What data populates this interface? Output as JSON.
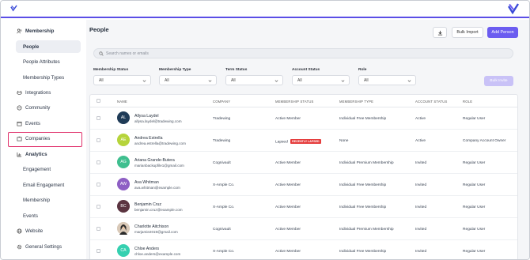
{
  "app": {
    "logo_icon": "tradewing-logo-icon",
    "accent_color": "#5b4ee6"
  },
  "sidebar": {
    "items": [
      {
        "label": "Membership",
        "icon": "people-icon",
        "level": "parent"
      },
      {
        "label": "People",
        "level": "sub",
        "active": true
      },
      {
        "label": "People Attributes",
        "level": "sub"
      },
      {
        "label": "Membership Types",
        "level": "sub"
      },
      {
        "label": "Integrations",
        "icon": "plug-icon",
        "level": "parent"
      },
      {
        "label": "Community",
        "icon": "chat-icon",
        "level": "parent"
      },
      {
        "label": "Events",
        "icon": "calendar-icon",
        "level": "parent"
      },
      {
        "label": "Companies",
        "icon": "building-icon",
        "level": "parent",
        "highlighted": true
      },
      {
        "label": "Analytics",
        "icon": "chart-icon",
        "level": "parent",
        "bold": true
      },
      {
        "label": "Engagement",
        "level": "sub"
      },
      {
        "label": "Email Engagement",
        "level": "sub"
      },
      {
        "label": "Membership",
        "level": "sub"
      },
      {
        "label": "Events",
        "level": "sub"
      },
      {
        "label": "Website",
        "icon": "globe-icon",
        "level": "parent"
      },
      {
        "label": "General Settings",
        "icon": "gear-icon",
        "level": "parent"
      }
    ]
  },
  "header": {
    "title": "People",
    "download_icon": "download-icon",
    "bulk_import_label": "Bulk Import",
    "add_person_label": "Add Person"
  },
  "search": {
    "placeholder": "Search names or emails",
    "icon": "search-icon"
  },
  "filters": [
    {
      "label": "Membership Status",
      "value": "All"
    },
    {
      "label": "Membership Type",
      "value": "All"
    },
    {
      "label": "Term Status",
      "value": "All"
    },
    {
      "label": "Account Status",
      "value": "All"
    },
    {
      "label": "Role",
      "value": "All"
    }
  ],
  "bulk_invite_label": "Bulk Invite",
  "table": {
    "columns": [
      "NAME",
      "COMPANY",
      "MEMBERSHIP STATUS",
      "MEMBERSHIP TYPE",
      "ACCOUNT STATUS",
      "ROLE"
    ],
    "rows": [
      {
        "initials": "AL",
        "avatar_color": "#1f3b57",
        "name": "Allysa Laydel",
        "email": "allysa.laydel@tradewing.com",
        "company": "Tradewing",
        "membership_status": "Active Member",
        "badge": "",
        "membership_type": "Individual Free Membership",
        "account_status": "Active",
        "role": "Regular User"
      },
      {
        "initials": "AE",
        "avatar_color": "#b6d43b",
        "name": "Andrea Estrella",
        "email": "andrea.estrella@tradewing.com",
        "company": "Tradewing",
        "membership_status": "Lapsed",
        "badge": "RECENTLY LAPSED",
        "membership_type": "None",
        "account_status": "Active",
        "role": "Company Account Owner"
      },
      {
        "initials": "AG",
        "avatar_color": "#3fbf8f",
        "name": "Ariana Grande-Butera",
        "email": "marianbackupfile1@gmail.com",
        "company": "Cognivault",
        "membership_status": "Active Member",
        "badge": "",
        "membership_type": "Individual Premium Membership",
        "account_status": "Invited",
        "role": "Regular User"
      },
      {
        "initials": "AW",
        "avatar_color": "#8e5fc4",
        "name": "Ava Whitman",
        "email": "ava.whitman@example.com",
        "company": "X-Ample Co.",
        "membership_status": "Active Member",
        "badge": "",
        "membership_type": "Individual Free Membership",
        "account_status": "Invited",
        "role": "Regular User"
      },
      {
        "initials": "BC",
        "avatar_color": "#5b3440",
        "name": "Benjamin Cruz",
        "email": "benjamin.cruz@example.com",
        "company": "X-Ample Co.",
        "membership_status": "Active Member",
        "badge": "",
        "membership_type": "Individual Free Membership",
        "account_status": "Invited",
        "role": "Regular User"
      },
      {
        "initials": "",
        "avatar_color": "#d9c9b8",
        "avatar_photo": true,
        "name": "Charlotte Aitchison",
        "email": "marjamie2019@gmail.com",
        "company": "Cognivault",
        "membership_status": "Active Member",
        "badge": "",
        "membership_type": "Individual Premium Membership",
        "account_status": "Invited",
        "role": "Regular User"
      },
      {
        "initials": "CA",
        "avatar_color": "#35d0b0",
        "name": "Chloe Anders",
        "email": "chloe.anders@example.com",
        "company": "X-Ample Co.",
        "membership_status": "Active Member",
        "badge": "",
        "membership_type": "Individual Free Membership",
        "account_status": "Invited",
        "role": "Regular User"
      }
    ]
  }
}
